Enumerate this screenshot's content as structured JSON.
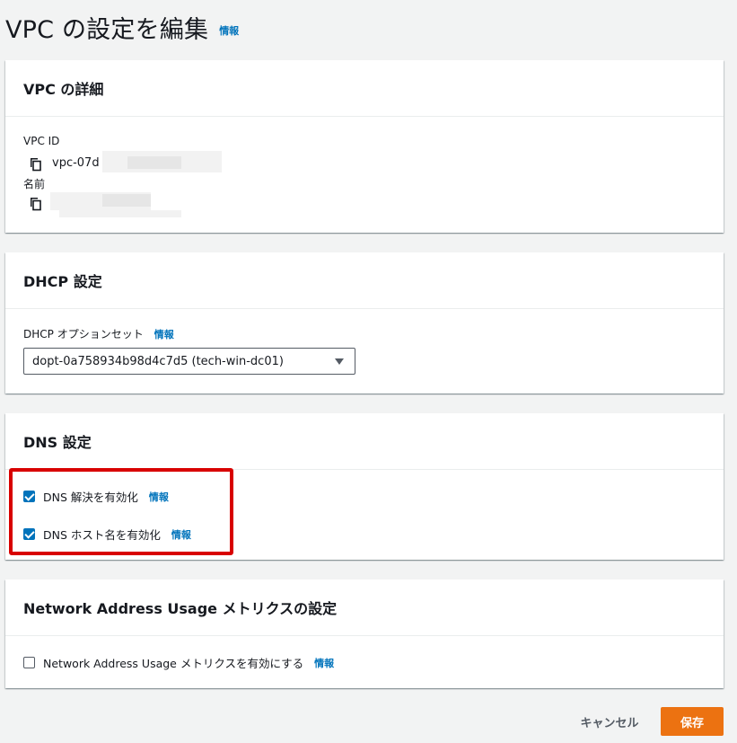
{
  "header": {
    "title": "VPC の設定を編集",
    "info": "情報"
  },
  "vpc_details": {
    "title": "VPC の詳細",
    "vpc_id_label": "VPC ID",
    "vpc_id_value": "vpc-07d",
    "name_label": "名前"
  },
  "dhcp": {
    "title": "DHCP 設定",
    "option_set_label": "DHCP オプションセット",
    "info": "情報",
    "selected_value": "dopt-0a758934b98d4c7d5 (tech-win-dc01)"
  },
  "dns": {
    "title": "DNS 設定",
    "resolution_label": "DNS 解決を有効化",
    "resolution_checked": true,
    "hostnames_label": "DNS ホスト名を有効化",
    "hostnames_checked": true,
    "info": "情報"
  },
  "nau": {
    "title": "Network Address Usage メトリクスの設定",
    "checkbox_label": "Network Address Usage メトリクスを有効にする",
    "checked": false,
    "info": "情報"
  },
  "footer": {
    "cancel_label": "キャンセル",
    "save_label": "保存"
  },
  "colors": {
    "accent": "#0073bb",
    "primary_button": "#ec7211",
    "highlight": "#d80000",
    "background": "#f2f3f3"
  }
}
